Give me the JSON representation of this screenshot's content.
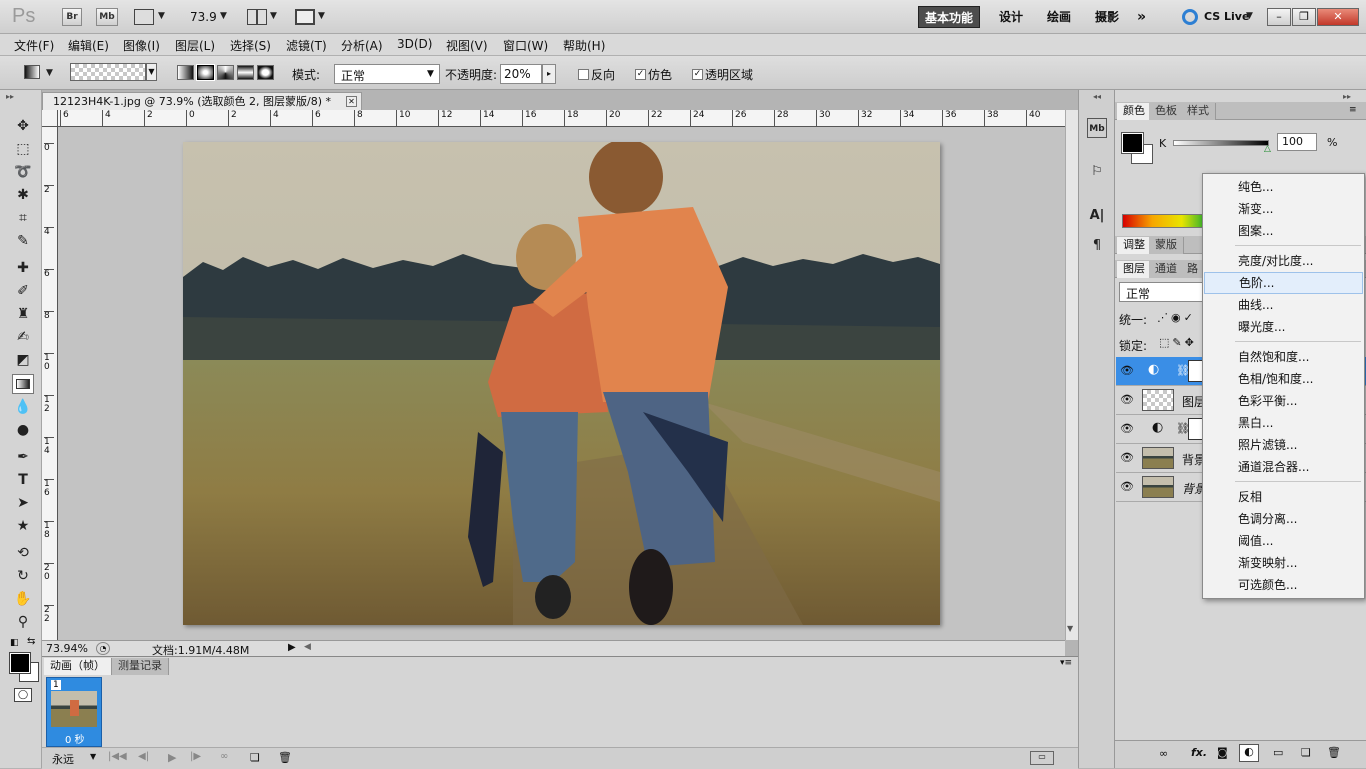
{
  "appbar": {
    "logo": "Ps",
    "bridge": "Br",
    "mini_bridge": "Mb",
    "zoom": "73.9",
    "workspaces": [
      "基本功能",
      "设计",
      "绘画",
      "摄影"
    ],
    "overflow": "»",
    "cs_live": "CS Live"
  },
  "menubar": {
    "items": [
      "文件(F)",
      "编辑(E)",
      "图像(I)",
      "图层(L)",
      "选择(S)",
      "滤镜(T)",
      "分析(A)",
      "3D(D)",
      "视图(V)",
      "窗口(W)",
      "帮助(H)"
    ]
  },
  "options": {
    "mode_label": "模式:",
    "mode_value": "正常",
    "opacity_label": "不透明度:",
    "opacity_value": "20%",
    "reverse": "反向",
    "dither": "仿色",
    "transparency": "透明区域"
  },
  "document": {
    "tab_title": "12123H4K-1.jpg @ 73.9% (选取颜色 2, 图层蒙版/8) *",
    "ruler_h": [
      "6",
      "4",
      "2",
      "0",
      "2",
      "4",
      "6",
      "8",
      "10",
      "12",
      "14",
      "16",
      "18",
      "20",
      "22",
      "24",
      "26",
      "28",
      "30",
      "32",
      "34",
      "36",
      "38",
      "40"
    ],
    "ruler_v": [
      "0",
      "2",
      "4",
      "6",
      "8",
      "1 0",
      "1 2",
      "1 4",
      "1 6",
      "1 8",
      "2 0",
      "2 2"
    ]
  },
  "status": {
    "zoom": "73.94%",
    "doc_info": "文档:1.91M/4.48M"
  },
  "animation": {
    "tabs": [
      "动画（帧）",
      "测量记录"
    ],
    "frame_number": "1",
    "frame_delay": "0 秒",
    "loop": "永远"
  },
  "color_panel": {
    "tabs": [
      "颜色",
      "色板",
      "样式"
    ],
    "channel": "K",
    "value": "100",
    "unit": "%"
  },
  "adjust_panel": {
    "tabs": [
      "调整",
      "蒙版"
    ]
  },
  "layers_panel": {
    "tabs": [
      "图层",
      "通道",
      "路"
    ],
    "blend_mode": "正常",
    "unify_label": "统一:",
    "lock_label": "锁定:",
    "layers": [
      {
        "name": ""
      },
      {
        "name": "图层"
      },
      {
        "name": ""
      },
      {
        "name": "背景"
      },
      {
        "name": "背景"
      }
    ]
  },
  "dropdown": {
    "items": [
      "纯色...",
      "渐变...",
      "图案...",
      "亮度/对比度...",
      "色阶...",
      "曲线...",
      "曝光度...",
      "自然饱和度...",
      "色相/饱和度...",
      "色彩平衡...",
      "黑白...",
      "照片滤镜...",
      "通道混合器...",
      "反相",
      "色调分离...",
      "阈值...",
      "渐变映射...",
      "可选颜色..."
    ],
    "highlighted": "色阶..."
  }
}
